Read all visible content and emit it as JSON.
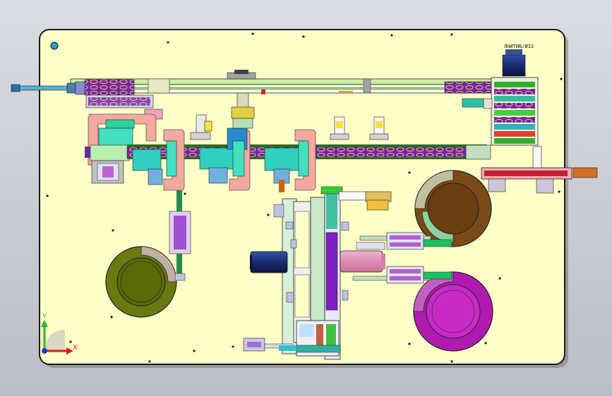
{
  "view": {
    "background_top": "#d9dde4",
    "background_bottom": "#b9bec8",
    "plate_color": "#ffffc8",
    "plate_border": "#1a1a1a"
  },
  "triad": {
    "x_label": "X",
    "y_label": "Y",
    "x_color": "#e8141a",
    "y_color": "#2ab52a",
    "z_color": "#1a3ad0"
  },
  "motor_label": "ЛНИТИБ/ИЗЗ",
  "bowls": {
    "olive_color": "#6b7a10",
    "brown_color": "#7a4a16",
    "magenta_color": "#b01ab0"
  }
}
